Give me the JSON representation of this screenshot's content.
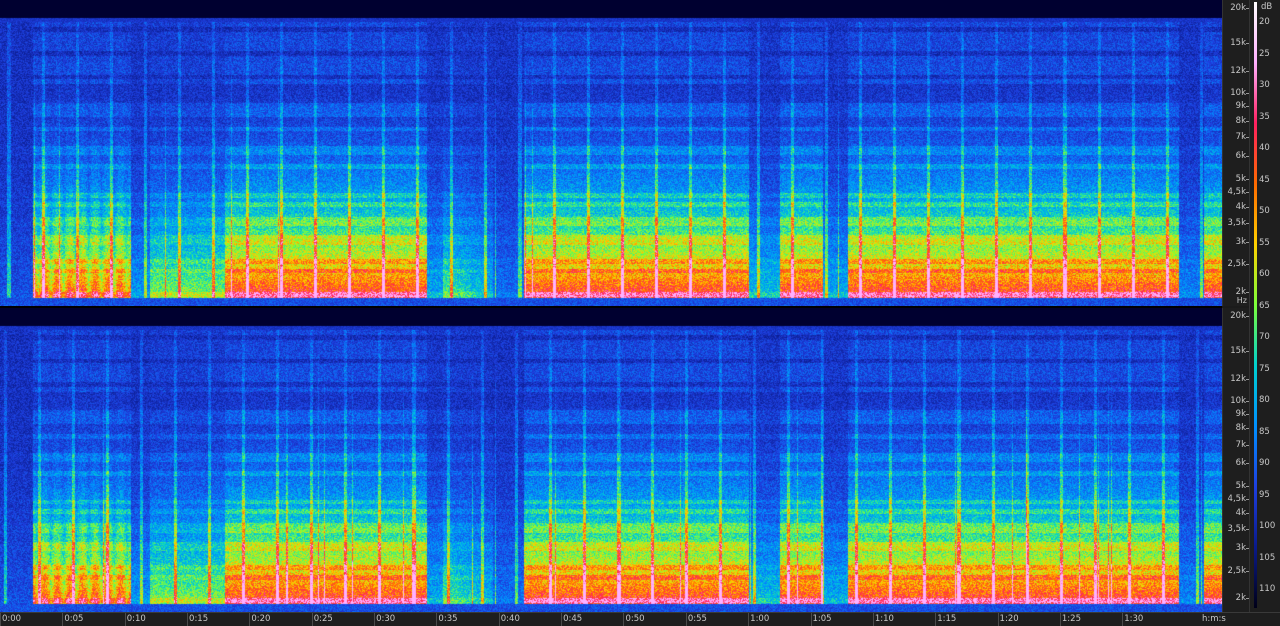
{
  "spectrogram": {
    "duration_seconds": 98,
    "time_labels": [
      "0:00",
      "0:05",
      "0:10",
      "0:15",
      "0:20",
      "0:25",
      "0:30",
      "0:35",
      "0:40",
      "0:45",
      "0:50",
      "0:55",
      "1:00",
      "1:05",
      "1:10",
      "1:15",
      "1:20",
      "1:25",
      "1:30"
    ],
    "time_unit": "h:m:s",
    "freq_unit": "Hz",
    "freq_labels": [
      {
        "label": "20k",
        "hz": 20000
      },
      {
        "label": "15k",
        "hz": 15000
      },
      {
        "label": "12k",
        "hz": 12000
      },
      {
        "label": "10k",
        "hz": 10000
      },
      {
        "label": "9k",
        "hz": 9000
      },
      {
        "label": "8k",
        "hz": 8000
      },
      {
        "label": "7k",
        "hz": 7000
      },
      {
        "label": "6k",
        "hz": 6000
      },
      {
        "label": "5k",
        "hz": 5000
      },
      {
        "label": "4,5k",
        "hz": 4500
      },
      {
        "label": "4k",
        "hz": 4000
      },
      {
        "label": "3,5k",
        "hz": 3500
      },
      {
        "label": "3k",
        "hz": 3000
      },
      {
        "label": "2,5k",
        "hz": 2500
      },
      {
        "label": "2k",
        "hz": 2000
      }
    ],
    "db_unit": "dB",
    "db_labels": [
      "20",
      "25",
      "30",
      "35",
      "40",
      "45",
      "50",
      "55",
      "60",
      "65",
      "70",
      "75",
      "80",
      "85",
      "90",
      "95",
      "100",
      "105",
      "110"
    ],
    "colors": {
      "background": "#1e1e1e",
      "low": "#0a1a8a",
      "mid_low": "#1e3fe0",
      "mid": "#00d0d0",
      "mid_high": "#7cff3a",
      "high": "#ffd000",
      "peak": "#ff2060",
      "max": "#ffffff"
    }
  }
}
